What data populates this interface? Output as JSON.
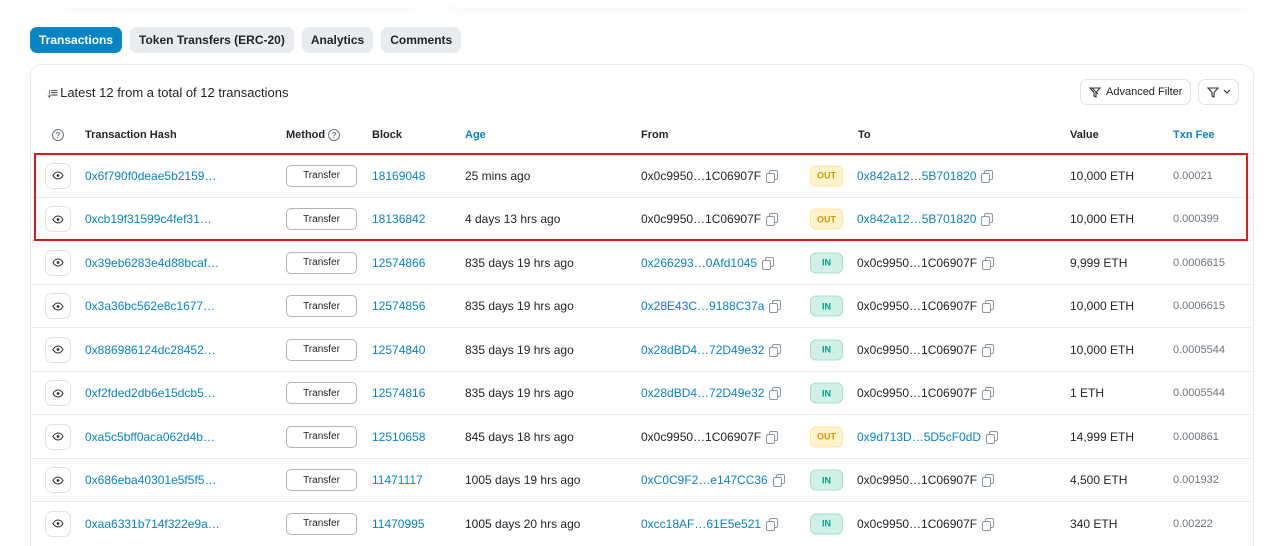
{
  "tabs": [
    {
      "label": "Transactions",
      "active": true
    },
    {
      "label": "Token Transfers (ERC-20)",
      "active": false
    },
    {
      "label": "Analytics",
      "active": false
    },
    {
      "label": "Comments",
      "active": false
    }
  ],
  "summary": "Latest 12 from a total of 12 transactions",
  "toolbar": {
    "advanced_filter": "Advanced Filter"
  },
  "columns": {
    "hash": "Transaction Hash",
    "method": "Method",
    "block": "Block",
    "age": "Age",
    "from": "From",
    "to": "To",
    "value": "Value",
    "fee": "Txn Fee"
  },
  "rows": [
    {
      "hash": "0x6f790f0deae5b2159…",
      "method": "Transfer",
      "block": "18169048",
      "age": "25 mins ago",
      "from": "0x0c9950…1C06907F",
      "dir": "OUT",
      "to": "0x842a12…5B701820",
      "value": "10,000 ETH",
      "fee": "0.00021"
    },
    {
      "hash": "0xcb19f31599c4fef31…",
      "method": "Transfer",
      "block": "18136842",
      "age": "4 days 13 hrs ago",
      "from": "0x0c9950…1C06907F",
      "dir": "OUT",
      "to": "0x842a12…5B701820",
      "value": "10,000 ETH",
      "fee": "0.000399"
    },
    {
      "hash": "0x39eb6283e4d88bcaf…",
      "method": "Transfer",
      "block": "12574866",
      "age": "835 days 19 hrs ago",
      "from": "0x266293…0Afd1045",
      "dir": "IN",
      "to": "0x0c9950…1C06907F",
      "value": "9,999 ETH",
      "fee": "0.0006615"
    },
    {
      "hash": "0x3a36bc562e8c1677…",
      "method": "Transfer",
      "block": "12574856",
      "age": "835 days 19 hrs ago",
      "from": "0x28E43C…9188C37a",
      "dir": "IN",
      "to": "0x0c9950…1C06907F",
      "value": "10,000 ETH",
      "fee": "0.0006615"
    },
    {
      "hash": "0x886986124dc28452…",
      "method": "Transfer",
      "block": "12574840",
      "age": "835 days 19 hrs ago",
      "from": "0x28dBD4…72D49e32",
      "dir": "IN",
      "to": "0x0c9950…1C06907F",
      "value": "10,000 ETH",
      "fee": "0.0005544"
    },
    {
      "hash": "0xf2fded2db6e15dcb5…",
      "method": "Transfer",
      "block": "12574816",
      "age": "835 days 19 hrs ago",
      "from": "0x28dBD4…72D49e32",
      "dir": "IN",
      "to": "0x0c9950…1C06907F",
      "value": "1 ETH",
      "fee": "0.0005544"
    },
    {
      "hash": "0xa5c5bff0aca062d4b…",
      "method": "Transfer",
      "block": "12510658",
      "age": "845 days 18 hrs ago",
      "from": "0x0c9950…1C06907F",
      "dir": "OUT",
      "to": "0x9d713D…5D5cF0dD",
      "value": "14,999 ETH",
      "fee": "0.000861"
    },
    {
      "hash": "0x686eba40301e5f5f5…",
      "method": "Transfer",
      "block": "11471117",
      "age": "1005 days 19 hrs ago",
      "from": "0xC0C9F2…e147CC36",
      "dir": "IN",
      "to": "0x0c9950…1C06907F",
      "value": "4,500 ETH",
      "fee": "0.001932"
    },
    {
      "hash": "0xaa6331b714f322e9a…",
      "method": "Transfer",
      "block": "11470995",
      "age": "1005 days 20 hrs ago",
      "from": "0xcc18AF…61E5e521",
      "dir": "IN",
      "to": "0x0c9950…1C06907F",
      "value": "340 ETH",
      "fee": "0.00222"
    }
  ],
  "colors": {
    "accent": "#0784c3",
    "highlight": "#e01919",
    "out": "#cc9a06",
    "in": "#00a186"
  }
}
